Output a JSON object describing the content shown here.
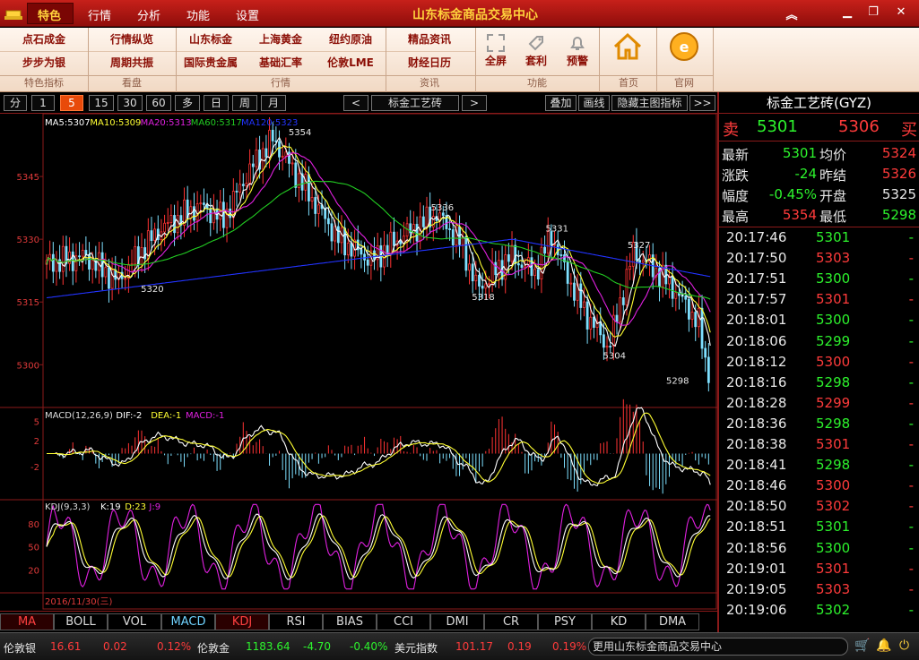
{
  "titlebar": {
    "title": "山东标金商品交易中心",
    "menus": [
      "特色",
      "行情",
      "分析",
      "功能",
      "设置"
    ]
  },
  "toolbar": {
    "rows": [
      [
        "点石成金",
        "行情纵览",
        "山东标金",
        "上海黄金",
        "纽约原油",
        "精品资讯"
      ],
      [
        "步步为银",
        "周期共振",
        "国际贵金属",
        "基础汇率",
        "伦敦LME",
        "财经日历"
      ]
    ],
    "big": [
      "全屏",
      "套利",
      "预警",
      "首页",
      "官网"
    ],
    "groups": [
      "特色指标",
      "看盘",
      "行情",
      "资讯",
      "功能",
      "首页",
      "官网"
    ]
  },
  "periodbar": {
    "periods": [
      "分",
      "1",
      "5",
      "15",
      "30",
      "60",
      "多",
      "日",
      "周",
      "月"
    ],
    "active": "5",
    "prev": "<",
    "next": ">",
    "symbol": "标金工艺砖",
    "right": [
      "叠加",
      "画线",
      "隐藏主图指标",
      ">>"
    ]
  },
  "main_chart": {
    "ma_legend": [
      {
        "t": "MA5:5307",
        "c": "#ffffff"
      },
      {
        "t": "MA10:5309",
        "c": "#ffff33"
      },
      {
        "t": "MA20:5313",
        "c": "#e020e0"
      },
      {
        "t": "MA60:5317",
        "c": "#22cc22"
      },
      {
        "t": "MA120:5323",
        "c": "#2233ff"
      }
    ],
    "y_ticks": [
      "5345",
      "5330",
      "5315",
      "5300"
    ],
    "annotations": [
      "5354",
      "5336",
      "5331",
      "5327",
      "5320",
      "5318",
      "5304",
      "5298"
    ],
    "date": "2016/11/30(三)"
  },
  "macd": {
    "legend": [
      {
        "t": "MACD(12,26,9)",
        "c": "#dddddd"
      },
      {
        "t": "DIF:-2",
        "c": "#ffffff"
      },
      {
        "t": "DEA:-1",
        "c": "#ffff33"
      },
      {
        "t": "MACD:-1",
        "c": "#e020e0"
      }
    ],
    "y_ticks": [
      "5",
      "2",
      "-2"
    ]
  },
  "kdj": {
    "legend": [
      {
        "t": "KDJ(9,3,3)",
        "c": "#dddddd"
      },
      {
        "t": "K:19",
        "c": "#ffffff"
      },
      {
        "t": "D:23",
        "c": "#ffff33"
      },
      {
        "t": "J:9",
        "c": "#e020e0"
      }
    ],
    "y_ticks": [
      "80",
      "50",
      "20"
    ]
  },
  "indicators": [
    "MA",
    "BOLL",
    "VOL",
    "MACD",
    "KDJ",
    "RSI",
    "BIAS",
    "CCI",
    "DMI",
    "CR",
    "PSY",
    "KD",
    "DMA"
  ],
  "ticker": [
    {
      "name": "伦敦银",
      "price": "16.61",
      "chg": "0.02",
      "pct": "0.12%"
    },
    {
      "name": "伦敦金",
      "price": "1183.64",
      "chg": "-4.70",
      "pct": "-0.40%"
    },
    {
      "name": "美元指数",
      "price": "101.17",
      "chg": "0.19",
      "pct": "0.19%"
    }
  ],
  "notice": "更用山东标金商品交易中心",
  "quote": {
    "title": "标金工艺砖(GYZ)",
    "sell_label": "卖",
    "sell": "5301",
    "buy": "5306",
    "buy_label": "买",
    "rows": [
      {
        "l1": "最新",
        "v1": "5301",
        "l2": "均价",
        "v2": "5324"
      },
      {
        "l1": "涨跌",
        "v1": "-24",
        "l2": "昨结",
        "v2": "5326"
      },
      {
        "l1": "幅度",
        "v1": "-0.45%",
        "l2": "开盘",
        "v2": "5325"
      },
      {
        "l1": "最高",
        "v1": "5354",
        "l2": "最低",
        "v2": "5298"
      }
    ],
    "colors": {
      "up": "#ff3b3b",
      "down": "#2df32d"
    }
  },
  "trades": [
    {
      "time": "20:17:46",
      "price": "5301",
      "dir": "down"
    },
    {
      "time": "20:17:50",
      "price": "5303",
      "dir": "up"
    },
    {
      "time": "20:17:51",
      "price": "5300",
      "dir": "down"
    },
    {
      "time": "20:17:57",
      "price": "5301",
      "dir": "up"
    },
    {
      "time": "20:18:01",
      "price": "5300",
      "dir": "down"
    },
    {
      "time": "20:18:06",
      "price": "5299",
      "dir": "down"
    },
    {
      "time": "20:18:12",
      "price": "5300",
      "dir": "up"
    },
    {
      "time": "20:18:16",
      "price": "5298",
      "dir": "down"
    },
    {
      "time": "20:18:28",
      "price": "5299",
      "dir": "up"
    },
    {
      "time": "20:18:36",
      "price": "5298",
      "dir": "down"
    },
    {
      "time": "20:18:38",
      "price": "5301",
      "dir": "up"
    },
    {
      "time": "20:18:41",
      "price": "5298",
      "dir": "down"
    },
    {
      "time": "20:18:46",
      "price": "5300",
      "dir": "up"
    },
    {
      "time": "20:18:50",
      "price": "5302",
      "dir": "up"
    },
    {
      "time": "20:18:51",
      "price": "5301",
      "dir": "down"
    },
    {
      "time": "20:18:56",
      "price": "5300",
      "dir": "down"
    },
    {
      "time": "20:19:01",
      "price": "5301",
      "dir": "up"
    },
    {
      "time": "20:19:05",
      "price": "5303",
      "dir": "up"
    },
    {
      "time": "20:19:06",
      "price": "5302",
      "dir": "down"
    }
  ]
}
